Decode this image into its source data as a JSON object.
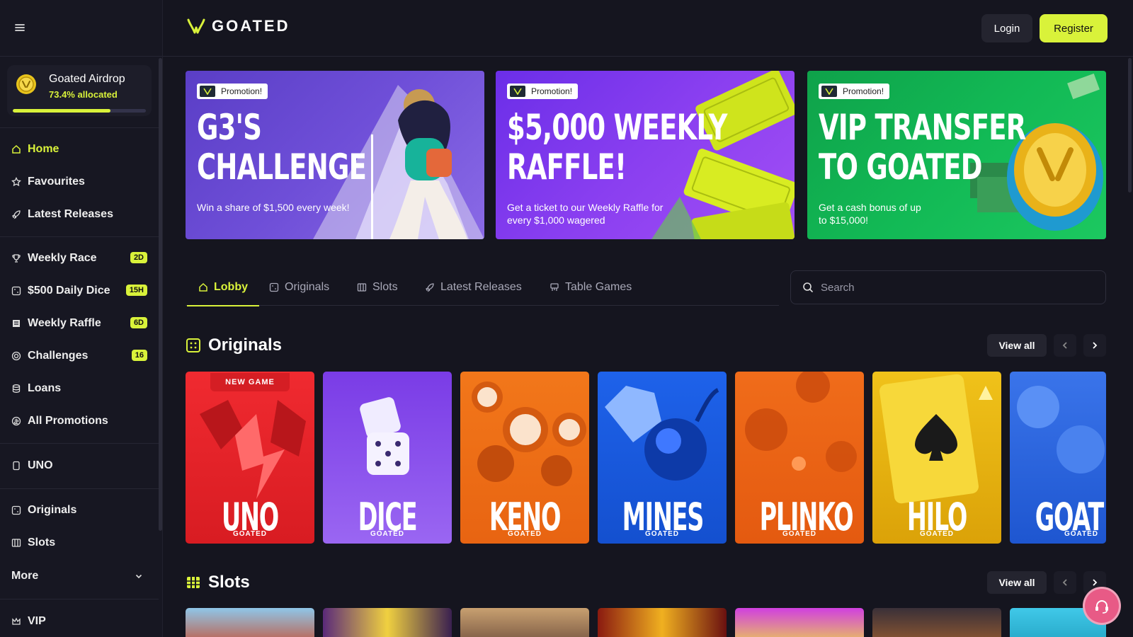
{
  "header": {
    "logo_text": "GOATED",
    "login_label": "Login",
    "register_label": "Register"
  },
  "airdrop": {
    "title": "Goated Airdrop",
    "allocated_text": "73.4% allocated",
    "progress_percent": 73.4
  },
  "sidebar": {
    "group1": [
      {
        "label": "Home",
        "icon": "home-icon"
      },
      {
        "label": "Favourites",
        "icon": "star-icon"
      },
      {
        "label": "Latest Releases",
        "icon": "rocket-icon"
      }
    ],
    "group2": [
      {
        "label": "Weekly Race",
        "icon": "trophy-icon",
        "badge": "2D"
      },
      {
        "label": "$500 Daily Dice",
        "icon": "dice-icon",
        "badge": "15H"
      },
      {
        "label": "Weekly Raffle",
        "icon": "ticket-icon",
        "badge": "6D"
      },
      {
        "label": "Challenges",
        "icon": "target-icon",
        "badge": "16"
      },
      {
        "label": "Loans",
        "icon": "coins-icon"
      },
      {
        "label": "All Promotions",
        "icon": "gift-icon"
      }
    ],
    "group3": [
      {
        "label": "UNO",
        "icon": "card-icon"
      }
    ],
    "group4": [
      {
        "label": "Originals",
        "icon": "dice-icon"
      },
      {
        "label": "Slots",
        "icon": "slots-icon"
      }
    ],
    "more_label": "More",
    "vip_label": "VIP"
  },
  "banners": [
    {
      "promo": "Promotion!",
      "headline_line1": "G3'S",
      "headline_line2": "CHALLENGE",
      "desc": "Win a share of $1,500 every week!"
    },
    {
      "promo": "Promotion!",
      "headline_line1": "$5,000 WEEKLY",
      "headline_line2": "RAFFLE!",
      "desc": "Get a ticket to our Weekly Raffle for every $1,000 wagered"
    },
    {
      "promo": "Promotion!",
      "headline_line1": "VIP TRANSFER",
      "headline_line2": "TO GOATED",
      "desc": "Get a cash bonus of up to $15,000!"
    }
  ],
  "tabs": [
    {
      "label": "Lobby",
      "icon": "home-icon",
      "active": true
    },
    {
      "label": "Originals",
      "icon": "dice-icon"
    },
    {
      "label": "Slots",
      "icon": "slots-icon"
    },
    {
      "label": "Latest Releases",
      "icon": "rocket-icon"
    },
    {
      "label": "Table Games",
      "icon": "table-icon"
    }
  ],
  "search": {
    "placeholder": "Search"
  },
  "originals": {
    "title": "Originals",
    "view_all": "View all",
    "new_game_tag": "NEW GAME",
    "brand": "GOATED",
    "games": [
      {
        "name": "UNO",
        "color": "#e3242b"
      },
      {
        "name": "DICE",
        "color": "#8a52ee"
      },
      {
        "name": "KENO",
        "color": "#f07a1c"
      },
      {
        "name": "MINES",
        "color": "#1a5fe0"
      },
      {
        "name": "PLINKO",
        "color": "#ee6a16"
      },
      {
        "name": "HILO",
        "color": "#e4b40c"
      },
      {
        "name": "GOAT",
        "color": "#2a62d8"
      }
    ]
  },
  "slots": {
    "title": "Slots",
    "view_all": "View all"
  },
  "colors": {
    "accent": "#d9f23a",
    "background": "#15151f",
    "sidebar": "#171722"
  }
}
